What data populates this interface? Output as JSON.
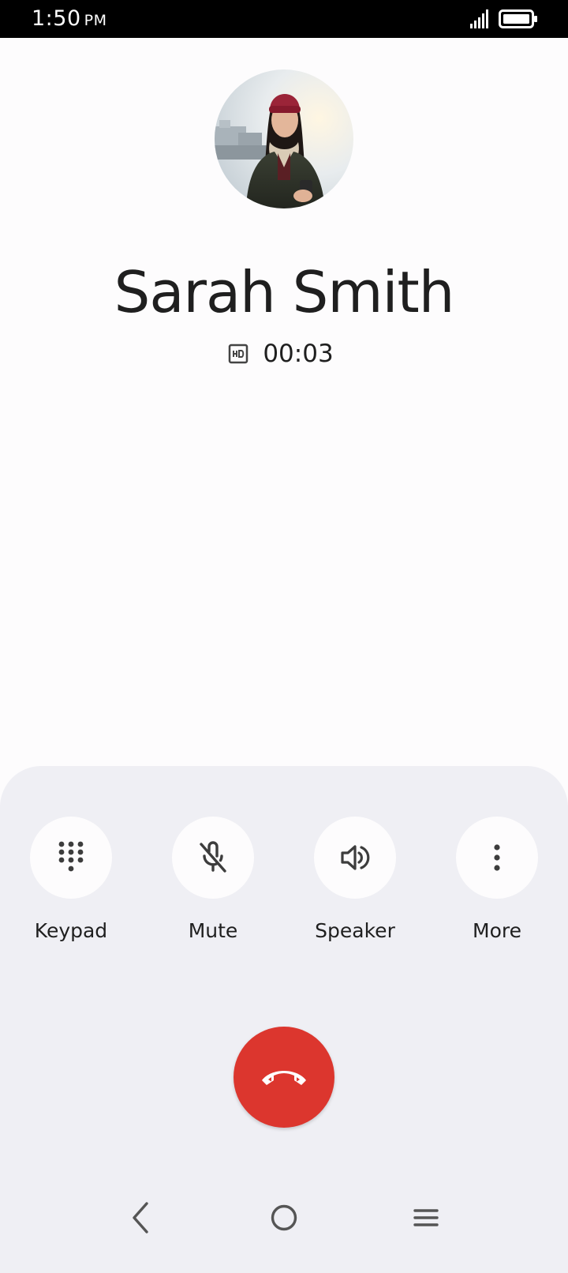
{
  "status_bar": {
    "time": "1:50",
    "ampm": "PM"
  },
  "contact": {
    "name": "Sarah Smith",
    "call_timer": "00:03",
    "call_quality_icon": "hd-icon"
  },
  "controls": [
    {
      "label": "Keypad",
      "icon": "keypad-icon"
    },
    {
      "label": "Mute",
      "icon": "mic-off-icon"
    },
    {
      "label": "Speaker",
      "icon": "speaker-icon"
    },
    {
      "label": "More",
      "icon": "more-vert-icon"
    }
  ],
  "end_call": {
    "icon": "end-call-icon",
    "color": "#dc362e"
  },
  "nav": {
    "back": "back-icon",
    "home": "home-icon",
    "recents": "menu-icon"
  },
  "colors": {
    "background": "#fdfcfd",
    "sheet": "#efeff4",
    "text": "#1f1f1f"
  }
}
